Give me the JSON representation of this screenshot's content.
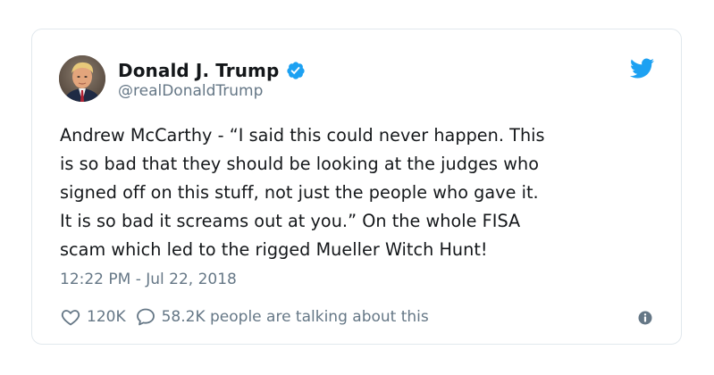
{
  "tweet": {
    "author": {
      "display_name": "Donald J. Trump",
      "handle": "@realDonaldTrump",
      "verified": true
    },
    "text": "Andrew McCarthy - “I said this could never happen. This\nis so bad that they should be looking at the judges who\nsigned off on this stuff, not just the people who gave it.\nIt is so bad it screams out at you.”  On the whole FISA\nscam which led to the rigged Mueller Witch Hunt!",
    "timestamp": "12:22 PM - Jul 22, 2018",
    "likes": "120K",
    "replies_text": "58.2K people are talking about this"
  },
  "colors": {
    "brand_blue": "#1da1f2",
    "text_primary": "#14171a",
    "text_secondary": "#657786",
    "border": "#e1e8ed"
  },
  "icons": {
    "verified": "verified-badge-icon",
    "brand": "twitter-bird-icon",
    "like": "heart-icon",
    "reply": "reply-bubble-icon",
    "info": "info-icon"
  }
}
